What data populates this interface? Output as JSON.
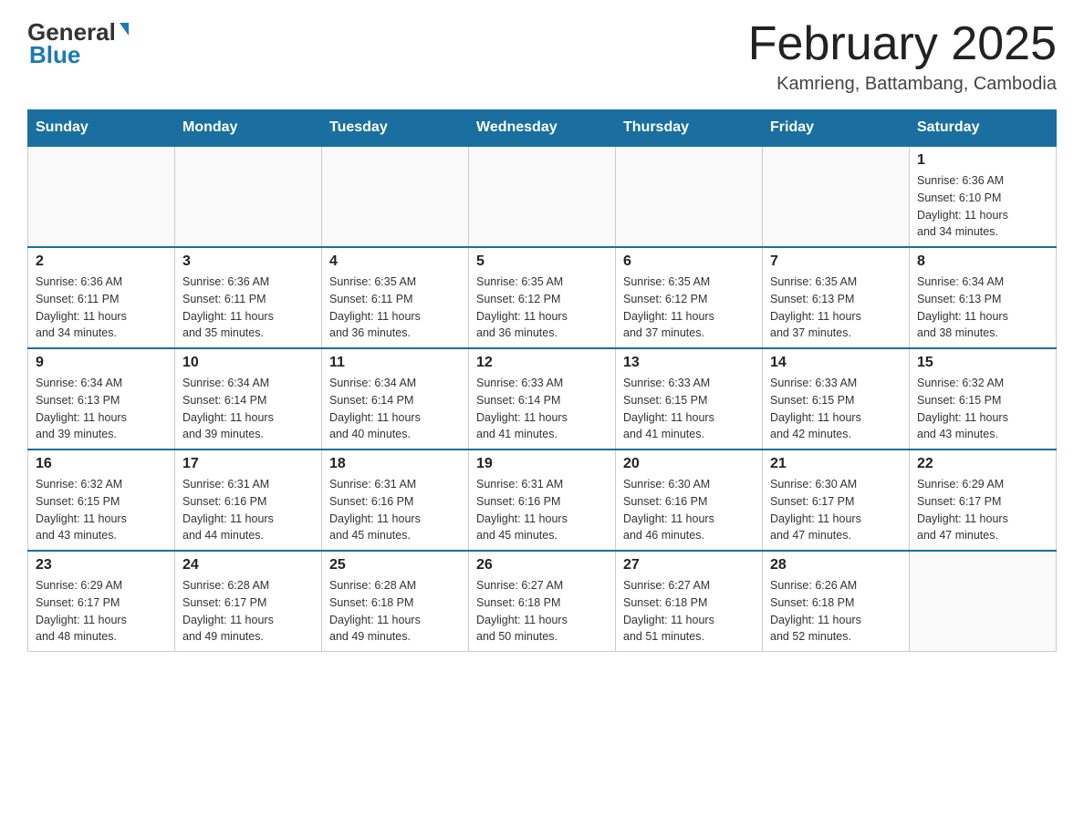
{
  "header": {
    "logo_general": "General",
    "logo_blue": "Blue",
    "main_title": "February 2025",
    "subtitle": "Kamrieng, Battambang, Cambodia"
  },
  "days_of_week": [
    "Sunday",
    "Monday",
    "Tuesday",
    "Wednesday",
    "Thursday",
    "Friday",
    "Saturday"
  ],
  "weeks": [
    {
      "days": [
        {
          "num": "",
          "info": "",
          "empty": true
        },
        {
          "num": "",
          "info": "",
          "empty": true
        },
        {
          "num": "",
          "info": "",
          "empty": true
        },
        {
          "num": "",
          "info": "",
          "empty": true
        },
        {
          "num": "",
          "info": "",
          "empty": true
        },
        {
          "num": "",
          "info": "",
          "empty": true
        },
        {
          "num": "1",
          "info": "Sunrise: 6:36 AM\nSunset: 6:10 PM\nDaylight: 11 hours\nand 34 minutes.",
          "empty": false
        }
      ]
    },
    {
      "days": [
        {
          "num": "2",
          "info": "Sunrise: 6:36 AM\nSunset: 6:11 PM\nDaylight: 11 hours\nand 34 minutes.",
          "empty": false
        },
        {
          "num": "3",
          "info": "Sunrise: 6:36 AM\nSunset: 6:11 PM\nDaylight: 11 hours\nand 35 minutes.",
          "empty": false
        },
        {
          "num": "4",
          "info": "Sunrise: 6:35 AM\nSunset: 6:11 PM\nDaylight: 11 hours\nand 36 minutes.",
          "empty": false
        },
        {
          "num": "5",
          "info": "Sunrise: 6:35 AM\nSunset: 6:12 PM\nDaylight: 11 hours\nand 36 minutes.",
          "empty": false
        },
        {
          "num": "6",
          "info": "Sunrise: 6:35 AM\nSunset: 6:12 PM\nDaylight: 11 hours\nand 37 minutes.",
          "empty": false
        },
        {
          "num": "7",
          "info": "Sunrise: 6:35 AM\nSunset: 6:13 PM\nDaylight: 11 hours\nand 37 minutes.",
          "empty": false
        },
        {
          "num": "8",
          "info": "Sunrise: 6:34 AM\nSunset: 6:13 PM\nDaylight: 11 hours\nand 38 minutes.",
          "empty": false
        }
      ]
    },
    {
      "days": [
        {
          "num": "9",
          "info": "Sunrise: 6:34 AM\nSunset: 6:13 PM\nDaylight: 11 hours\nand 39 minutes.",
          "empty": false
        },
        {
          "num": "10",
          "info": "Sunrise: 6:34 AM\nSunset: 6:14 PM\nDaylight: 11 hours\nand 39 minutes.",
          "empty": false
        },
        {
          "num": "11",
          "info": "Sunrise: 6:34 AM\nSunset: 6:14 PM\nDaylight: 11 hours\nand 40 minutes.",
          "empty": false
        },
        {
          "num": "12",
          "info": "Sunrise: 6:33 AM\nSunset: 6:14 PM\nDaylight: 11 hours\nand 41 minutes.",
          "empty": false
        },
        {
          "num": "13",
          "info": "Sunrise: 6:33 AM\nSunset: 6:15 PM\nDaylight: 11 hours\nand 41 minutes.",
          "empty": false
        },
        {
          "num": "14",
          "info": "Sunrise: 6:33 AM\nSunset: 6:15 PM\nDaylight: 11 hours\nand 42 minutes.",
          "empty": false
        },
        {
          "num": "15",
          "info": "Sunrise: 6:32 AM\nSunset: 6:15 PM\nDaylight: 11 hours\nand 43 minutes.",
          "empty": false
        }
      ]
    },
    {
      "days": [
        {
          "num": "16",
          "info": "Sunrise: 6:32 AM\nSunset: 6:15 PM\nDaylight: 11 hours\nand 43 minutes.",
          "empty": false
        },
        {
          "num": "17",
          "info": "Sunrise: 6:31 AM\nSunset: 6:16 PM\nDaylight: 11 hours\nand 44 minutes.",
          "empty": false
        },
        {
          "num": "18",
          "info": "Sunrise: 6:31 AM\nSunset: 6:16 PM\nDaylight: 11 hours\nand 45 minutes.",
          "empty": false
        },
        {
          "num": "19",
          "info": "Sunrise: 6:31 AM\nSunset: 6:16 PM\nDaylight: 11 hours\nand 45 minutes.",
          "empty": false
        },
        {
          "num": "20",
          "info": "Sunrise: 6:30 AM\nSunset: 6:16 PM\nDaylight: 11 hours\nand 46 minutes.",
          "empty": false
        },
        {
          "num": "21",
          "info": "Sunrise: 6:30 AM\nSunset: 6:17 PM\nDaylight: 11 hours\nand 47 minutes.",
          "empty": false
        },
        {
          "num": "22",
          "info": "Sunrise: 6:29 AM\nSunset: 6:17 PM\nDaylight: 11 hours\nand 47 minutes.",
          "empty": false
        }
      ]
    },
    {
      "days": [
        {
          "num": "23",
          "info": "Sunrise: 6:29 AM\nSunset: 6:17 PM\nDaylight: 11 hours\nand 48 minutes.",
          "empty": false
        },
        {
          "num": "24",
          "info": "Sunrise: 6:28 AM\nSunset: 6:17 PM\nDaylight: 11 hours\nand 49 minutes.",
          "empty": false
        },
        {
          "num": "25",
          "info": "Sunrise: 6:28 AM\nSunset: 6:18 PM\nDaylight: 11 hours\nand 49 minutes.",
          "empty": false
        },
        {
          "num": "26",
          "info": "Sunrise: 6:27 AM\nSunset: 6:18 PM\nDaylight: 11 hours\nand 50 minutes.",
          "empty": false
        },
        {
          "num": "27",
          "info": "Sunrise: 6:27 AM\nSunset: 6:18 PM\nDaylight: 11 hours\nand 51 minutes.",
          "empty": false
        },
        {
          "num": "28",
          "info": "Sunrise: 6:26 AM\nSunset: 6:18 PM\nDaylight: 11 hours\nand 52 minutes.",
          "empty": false
        },
        {
          "num": "",
          "info": "",
          "empty": true
        }
      ]
    }
  ]
}
